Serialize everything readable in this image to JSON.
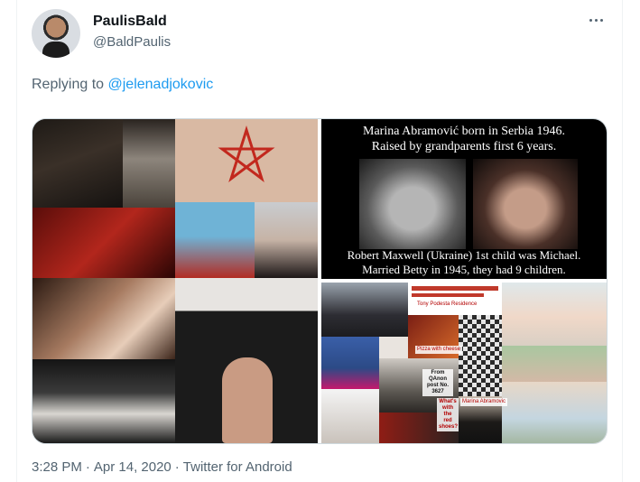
{
  "author": {
    "display_name": "PaulisBald",
    "handle": "@BaldPaulis"
  },
  "reply": {
    "prefix": "Replying to ",
    "mention": "@jelenadjokovic"
  },
  "media": {
    "top_right_caption_line1": "Marina Abramović born in Serbia 1946.",
    "top_right_caption_line2": "Raised by grandparents first 6 years.",
    "bottom_caption_line1": "Robert Maxwell (Ukraine) 1st child was Michael.",
    "bottom_caption_line2": "Married Betty in 1945, they had 9 children.",
    "note_podesta": "Tony Podesta Residence",
    "note_pizza": "Pizza with cheese",
    "note_qanon_line1": "From",
    "note_qanon_line2": "QAnon",
    "note_qanon_line3": "post No.",
    "note_qanon_line4": "3627",
    "note_marina": "Marina Abramovic",
    "note_what_line1": "What's",
    "note_what_line2": "with",
    "note_what_line3": "the",
    "note_what_line4": "red",
    "note_what_line5": "shoes?",
    "accent_red": "#b30000"
  },
  "footer": {
    "time": "3:28 PM",
    "separator": "·",
    "date": "Apr 14, 2020",
    "source": "Twitter for Android"
  },
  "colors": {
    "text_primary": "#0f1419",
    "text_secondary": "#536471",
    "link": "#1d9bf0",
    "border": "#cfd9de"
  },
  "icons": {
    "more": "more-horizontal-icon"
  }
}
